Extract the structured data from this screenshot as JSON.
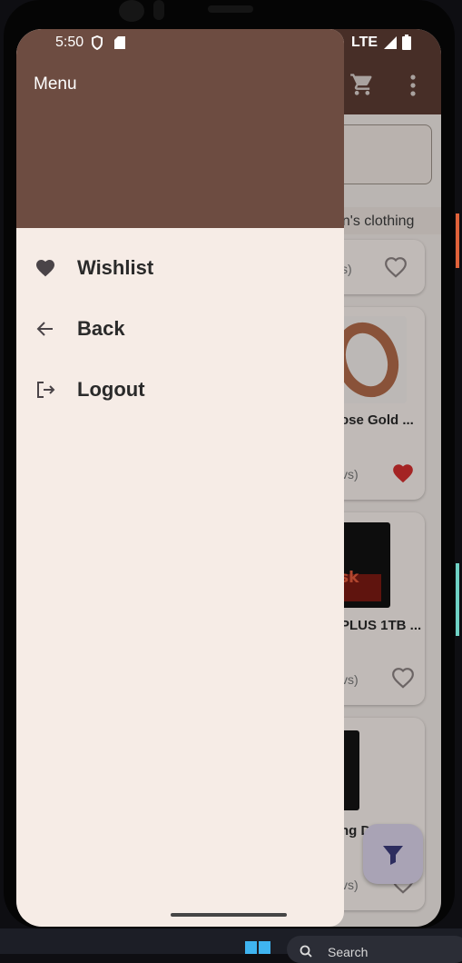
{
  "status_bar": {
    "time": "5:50",
    "network": "LTE"
  },
  "background_app": {
    "category_chip": "en's clothing",
    "cards": [
      {
        "rating_suffix": "s)",
        "favorited": false
      },
      {
        "title": "ose Gold ...",
        "rating_suffix": "vs)",
        "favorited": true
      },
      {
        "title": "PLUS 1TB ...",
        "rating_suffix": "vs)",
        "favorited": false
      },
      {
        "title": "ng D...",
        "rating_suffix": "vs)",
        "favorited": false
      }
    ],
    "ssd_brand_fragment": "sk",
    "colors": {
      "app_bar": "#5b3b33",
      "heart_filled": "#d32f2f"
    }
  },
  "drawer": {
    "title": "Menu",
    "header_color": "#6d4c41",
    "background_color": "#f6ece6",
    "items": [
      {
        "label": "Wishlist",
        "icon": "heart-icon"
      },
      {
        "label": "Back",
        "icon": "arrow-left-icon"
      },
      {
        "label": "Logout",
        "icon": "logout-icon"
      }
    ]
  },
  "taskbar": {
    "search_text": "Search"
  }
}
